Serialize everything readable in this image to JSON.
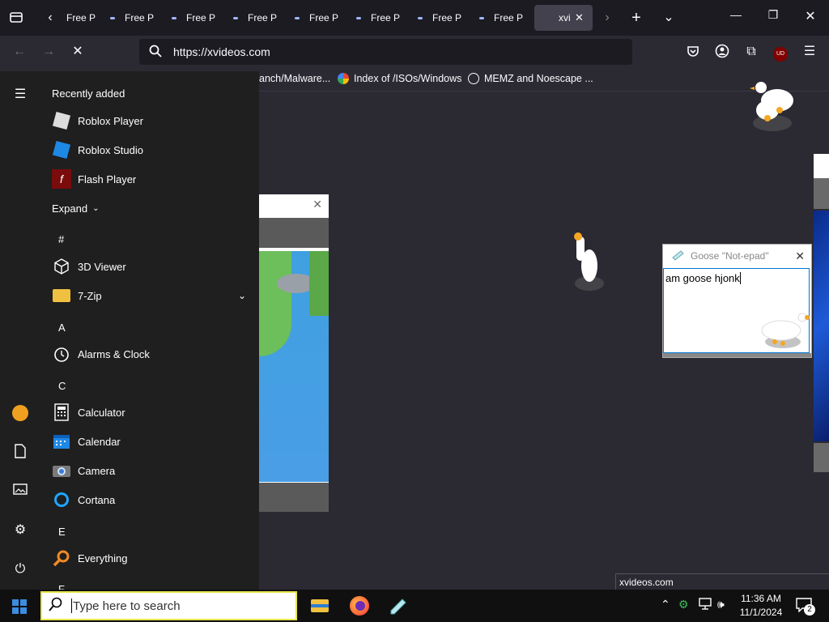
{
  "browser": {
    "tabs": [
      {
        "label": "Free P"
      },
      {
        "label": "Free P"
      },
      {
        "label": "Free P"
      },
      {
        "label": "Free P"
      },
      {
        "label": "Free P"
      },
      {
        "label": "Free P"
      },
      {
        "label": "Free P"
      },
      {
        "label": "Free P"
      }
    ],
    "active_tab": {
      "label": "xvi"
    },
    "url": "https://xvideos.com",
    "bookmarks": [
      {
        "label": "anch/Malware..."
      },
      {
        "label": "Index of /ISOs/Windows"
      },
      {
        "label": "MEMZ and Noescape ..."
      }
    ],
    "status_url": "xvideos.com",
    "ublock_badge": "UD"
  },
  "start_menu": {
    "section_title": "Recently added",
    "recent": [
      {
        "label": "Roblox Player",
        "icon": "roblox-player-icon"
      },
      {
        "label": "Roblox Studio",
        "icon": "roblox-studio-icon"
      },
      {
        "label": "Flash Player",
        "icon": "flash-player-icon"
      }
    ],
    "expand_label": "Expand",
    "letters": {
      "hash": "#",
      "a": "A",
      "c": "C",
      "e": "E",
      "f": "F"
    },
    "apps": {
      "viewer3d": "3D Viewer",
      "zip": "7-Zip",
      "alarms": "Alarms & Clock",
      "calculator": "Calculator",
      "calendar": "Calendar",
      "camera": "Camera",
      "cortana": "Cortana",
      "everything": "Everything"
    }
  },
  "notepad": {
    "title": "Goose \"Not-epad\"",
    "text": "am goose hjonk"
  },
  "taskbar": {
    "search_placeholder": "Type here to search",
    "time": "11:36 AM",
    "date": "11/1/2024",
    "notification_count": "2"
  },
  "colors": {
    "accent": "#0078d4",
    "search_border": "#e7e64b",
    "browser_bg": "#2b2a33"
  }
}
